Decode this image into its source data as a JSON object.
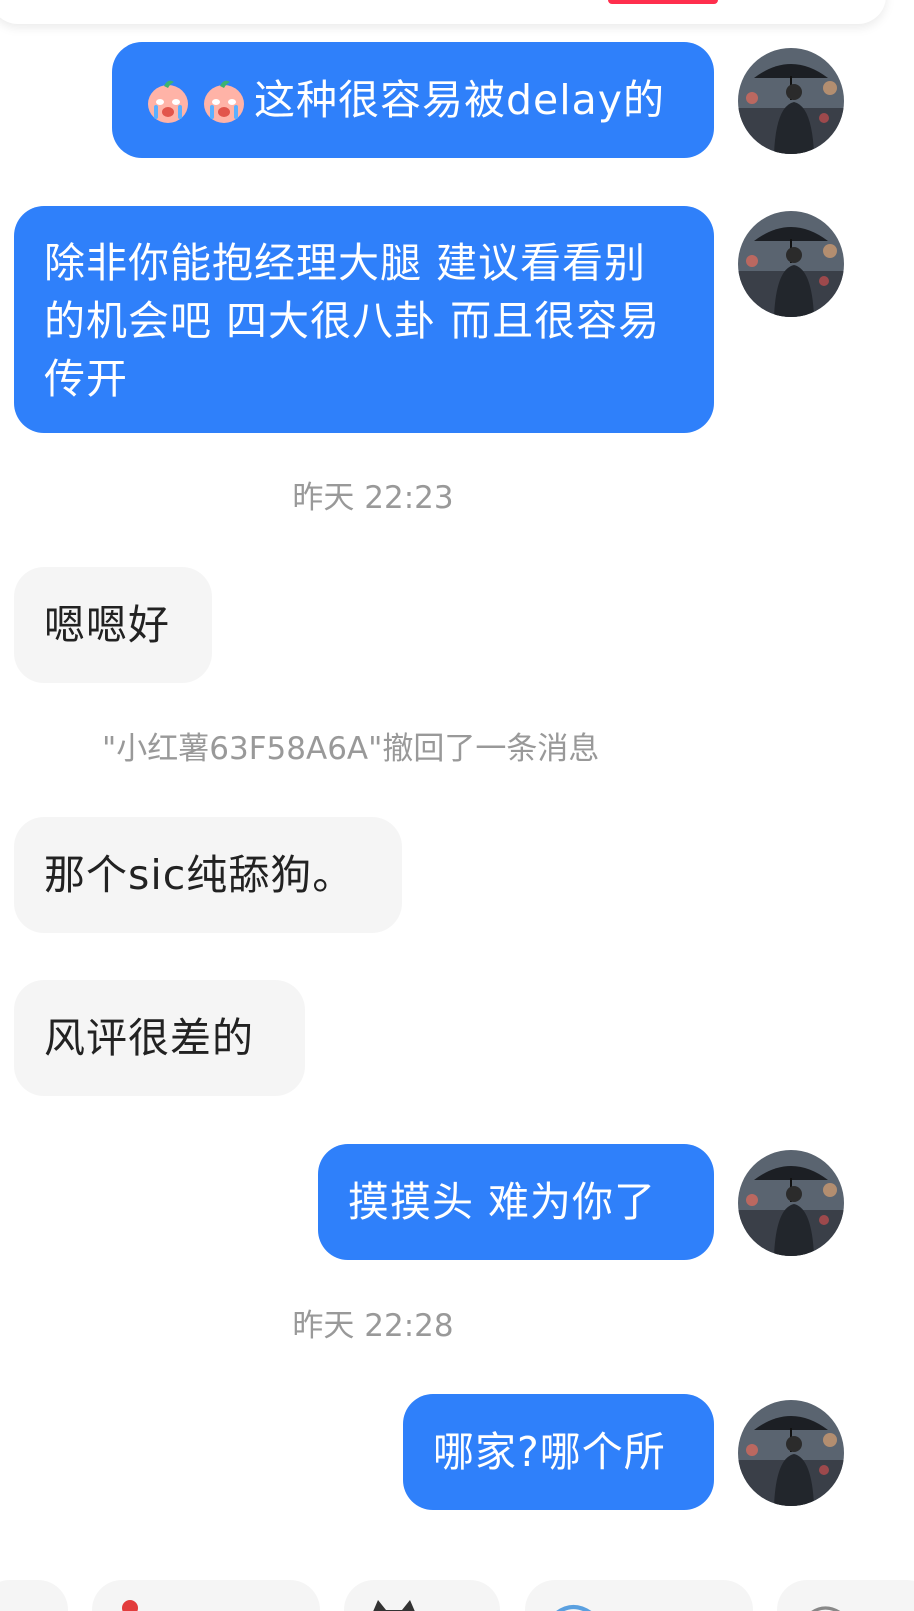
{
  "messages": {
    "m1": {
      "emoji_icon": "crying-peach-emoji-icon",
      "text": "这种很容易被delay的"
    },
    "m2": {
      "text": "除非你能抱经理大腿 建议看看别的机会吧 四大很八卦 而且很容易传开"
    },
    "ts1": "昨天 22:23",
    "m3": {
      "text": "嗯嗯好"
    },
    "recall": "\"小红薯63F58A6A\"撤回了一条消息",
    "m4": {
      "text": "那个sic纯舔狗。"
    },
    "m5": {
      "text": "风评很差的"
    },
    "m6": {
      "text": "摸摸头 难为你了"
    },
    "ts2": "昨天 22:28",
    "m7": {
      "text": "哪家?哪个所"
    }
  },
  "colors": {
    "sent_bubble": "#2f80fa",
    "recv_bubble": "#f5f5f5",
    "timestamp_text": "#999999",
    "accent": "#ff2e4d"
  },
  "icons": {
    "avatar": "man-with-umbrella-avatar",
    "emoji": "crying-peach-emoji-icon"
  }
}
